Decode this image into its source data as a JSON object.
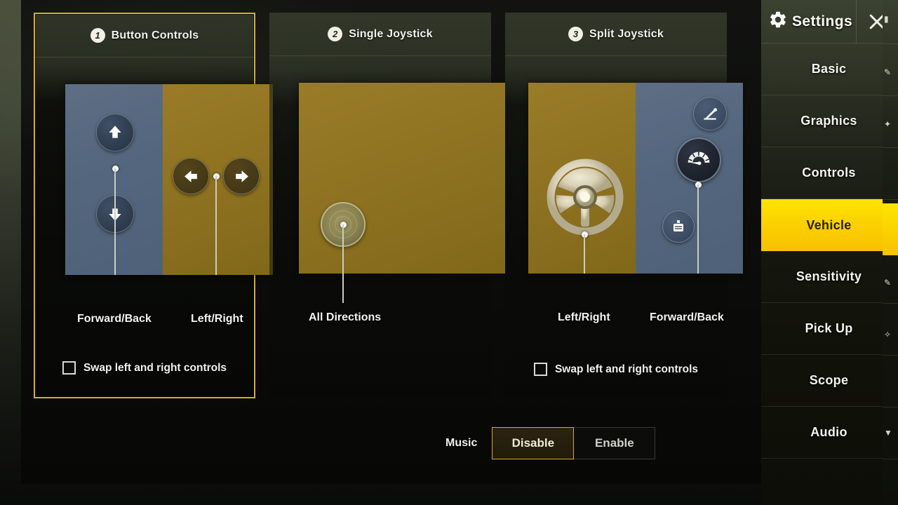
{
  "sidebar": {
    "title": "Settings",
    "gear_icon": "gear-icon",
    "close_icon": "close-icon",
    "items": [
      {
        "label": "Basic",
        "active": false
      },
      {
        "label": "Graphics",
        "active": false
      },
      {
        "label": "Controls",
        "active": false
      },
      {
        "label": "Vehicle",
        "active": true
      },
      {
        "label": "Sensitivity",
        "active": false
      },
      {
        "label": "Pick Up",
        "active": false
      },
      {
        "label": "Scope",
        "active": false
      },
      {
        "label": "Audio",
        "active": false
      }
    ],
    "active_color": "#fcd000",
    "active_text_color": "#23200a"
  },
  "panels": [
    {
      "number": "1",
      "title": "Button Controls",
      "selected": true,
      "left_caption": "Forward/Back",
      "right_caption": "Left/Right",
      "swap_label": "Swap left and right controls",
      "swap_checked": false,
      "left_half_color": "#55677e",
      "right_half_color": "#8f7322",
      "icons": [
        "arrow-up-icon",
        "arrow-down-icon",
        "arrow-left-icon",
        "arrow-right-icon"
      ]
    },
    {
      "number": "2",
      "title": "Single Joystick",
      "selected": false,
      "left_caption": "All Directions",
      "right_caption": "",
      "swap_label": "",
      "swap_checked": false,
      "left_half_color": "#8f7322",
      "right_half_color": "#8f7322",
      "icons": [
        "joystick-icon"
      ]
    },
    {
      "number": "3",
      "title": "Split Joystick",
      "selected": false,
      "left_caption": "Left/Right",
      "right_caption": "Forward/Back",
      "swap_label": "Swap left and right controls",
      "swap_checked": false,
      "left_half_color": "#8f7322",
      "right_half_color": "#55677e",
      "icons": [
        "steering-wheel-icon",
        "handbrake-icon",
        "speedometer-icon",
        "seat-icon"
      ]
    }
  ],
  "music": {
    "label": "Music",
    "options": [
      "Disable",
      "Enable"
    ],
    "selected": "Disable",
    "accent_color": "#d9a82f"
  }
}
